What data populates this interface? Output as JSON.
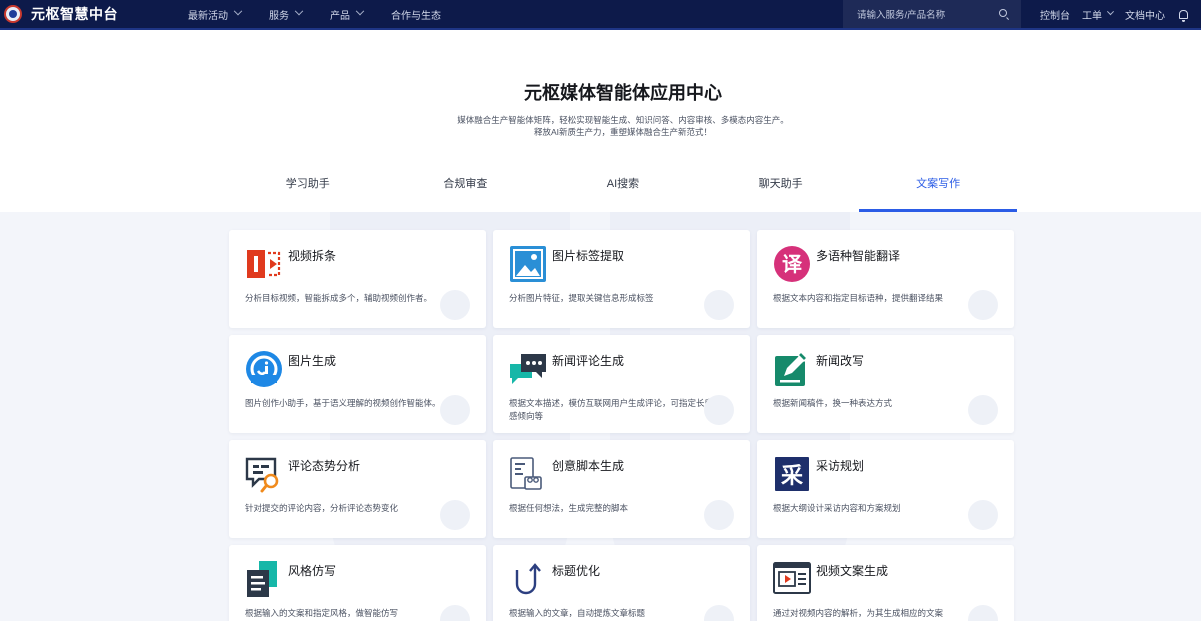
{
  "app": {
    "title": "元枢智慧中台"
  },
  "nav": {
    "items": [
      {
        "label": "最新活动",
        "has_dropdown": true
      },
      {
        "label": "服务",
        "has_dropdown": true
      },
      {
        "label": "产品",
        "has_dropdown": true
      },
      {
        "label": "合作与生态",
        "has_dropdown": false
      }
    ],
    "search_placeholder": "请输入服务/产品名称",
    "right": {
      "console": "控制台",
      "tickets": "工单",
      "docs": "文档中心"
    }
  },
  "hero": {
    "title": "元枢媒体智能体应用中心",
    "desc_line1": "媒体融合生产智能体矩阵，轻松实现智能生成、知识问答、内容审核、多模态内容生产。",
    "desc_line2": "释放AI新质生产力，重塑媒体融合生产新范式！"
  },
  "tabs": [
    "学习助手",
    "合规审查",
    "AI搜索",
    "聊天助手",
    "文案写作"
  ],
  "active_tab_index": 4,
  "colors": {
    "accent": "#2b5ce6",
    "nav_bg": "#0d1a4a"
  },
  "cards": [
    {
      "title": "视频拆条",
      "desc": "分析目标视频，智能拆成多个，辅助视频创作者。",
      "icon": "video-split-icon"
    },
    {
      "title": "图片标签提取",
      "desc": "分析图片特征，提取关键信息形成标签",
      "icon": "image-tag-icon"
    },
    {
      "title": "多语种智能翻译",
      "desc": "根据文本内容和指定目标语种，提供翻译结果",
      "icon": "translate-icon"
    },
    {
      "title": "图片生成",
      "desc": "图片创作小助手，基于语义理解的视频创作智能体。",
      "icon": "image-generate-icon"
    },
    {
      "title": "新闻评论生成",
      "desc": "根据文本描述，模仿互联网用户生成评论，可指定长度、情感倾向等",
      "icon": "news-comment-icon"
    },
    {
      "title": "新闻改写",
      "desc": "根据新闻稿件，换一种表达方式",
      "icon": "news-rewrite-icon"
    },
    {
      "title": "评论态势分析",
      "desc": "针对提交的评论内容，分析评论态势变化",
      "icon": "comment-analysis-icon"
    },
    {
      "title": "创意脚本生成",
      "desc": "根据任何想法，生成完整的脚本",
      "icon": "script-generate-icon"
    },
    {
      "title": "采访规划",
      "desc": "根据大纲设计采访内容和方案规划",
      "icon": "interview-plan-icon"
    },
    {
      "title": "风格仿写",
      "desc": "根据输入的文案和指定风格，做智能仿写",
      "icon": "style-imitate-icon"
    },
    {
      "title": "标题优化",
      "desc": "根据输入的文章，自动提炼文章标题",
      "icon": "title-optimize-icon"
    },
    {
      "title": "视频文案生成",
      "desc": "通过对视频内容的解析，为其生成相应的文案",
      "icon": "video-copy-icon"
    }
  ]
}
